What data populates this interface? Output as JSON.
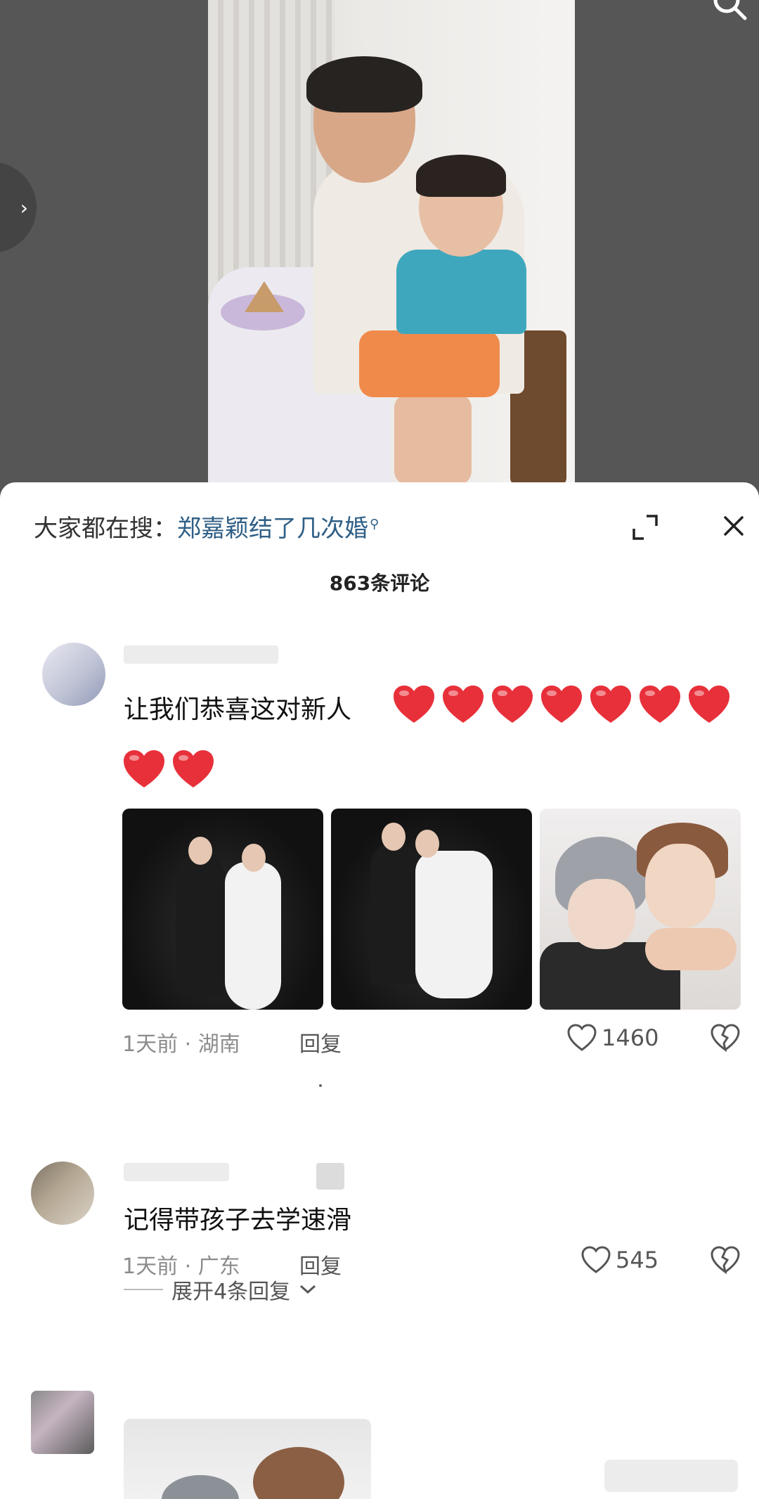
{
  "hot_search": {
    "label": "大家都在搜：",
    "term": "郑嘉颖结了几次婚",
    "search_glyph": "⚲"
  },
  "comments_count": "863条评论",
  "comments": [
    {
      "text": "让我们恭喜这对新人",
      "heart_count": 9,
      "meta": "1天前 · 湖南",
      "reply_label": "回复",
      "likes": "1460"
    },
    {
      "text": "记得带孩子去学速滑",
      "meta": "1天前 · 广东",
      "reply_label": "回复",
      "likes": "545",
      "expand_label": "展开4条回复"
    }
  ],
  "colors": {
    "accent_link": "#2f5f86",
    "heart": "#e8303a",
    "sheet_bg": "#ffffff"
  }
}
